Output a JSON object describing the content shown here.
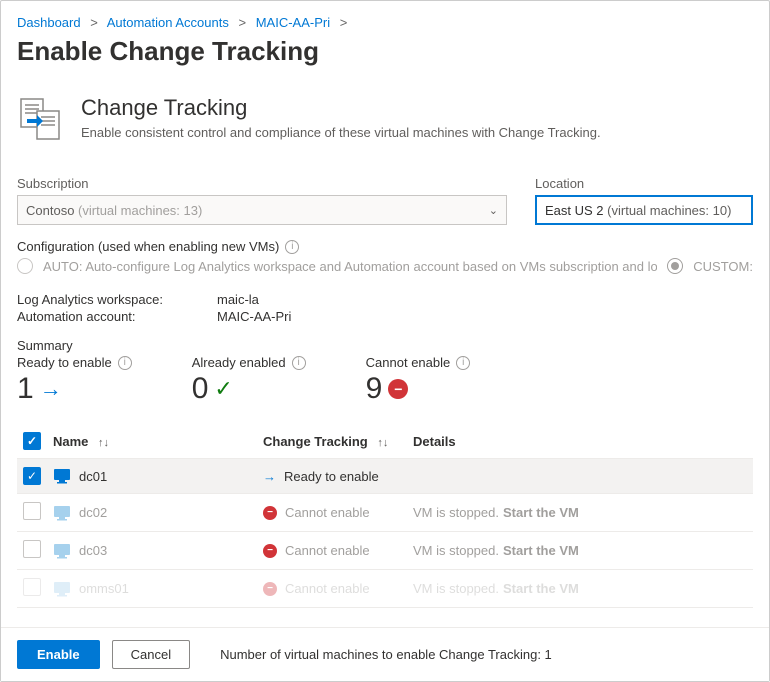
{
  "breadcrumb": {
    "items": [
      "Dashboard",
      "Automation Accounts",
      "MAIC-AA-Pri"
    ]
  },
  "page_title": "Enable Change Tracking",
  "hero": {
    "title": "Change Tracking",
    "subtitle": "Enable consistent control and compliance of these virtual machines with Change Tracking."
  },
  "subscription": {
    "label": "Subscription",
    "value": "Contoso",
    "count_label": "(virtual machines: 13)"
  },
  "location": {
    "label": "Location",
    "value": "East US 2",
    "count_label": "(virtual machines: 10)"
  },
  "config": {
    "label": "Configuration (used when enabling new VMs)",
    "auto_text": "AUTO: Auto-configure Log Analytics workspace and Automation account based on VMs subscription and location",
    "custom_text": "CUSTOM:"
  },
  "workspace": {
    "label": "Log Analytics workspace:",
    "value": "maic-la"
  },
  "automation": {
    "label": "Automation account:",
    "value": "MAIC-AA-Pri"
  },
  "summary": {
    "title": "Summary",
    "ready_label": "Ready to enable",
    "ready_value": "1",
    "already_label": "Already enabled",
    "already_value": "0",
    "cannot_label": "Cannot enable",
    "cannot_value": "9"
  },
  "table": {
    "headers": {
      "name": "Name",
      "change_tracking": "Change Tracking",
      "details": "Details"
    },
    "rows": [
      {
        "checked": true,
        "enabled": true,
        "name": "dc01",
        "status": "Ready to enable",
        "status_icon": "arrow",
        "details": "",
        "action": ""
      },
      {
        "checked": false,
        "enabled": false,
        "name": "dc02",
        "status": "Cannot enable",
        "status_icon": "no",
        "details": "VM is stopped.",
        "action": "Start the VM"
      },
      {
        "checked": false,
        "enabled": false,
        "name": "dc03",
        "status": "Cannot enable",
        "status_icon": "no",
        "details": "VM is stopped.",
        "action": "Start the VM"
      },
      {
        "checked": false,
        "enabled": false,
        "name": "omms01",
        "status": "Cannot enable",
        "status_icon": "no",
        "details": "VM is stopped.",
        "action": "Start the VM"
      }
    ]
  },
  "footer": {
    "enable": "Enable",
    "cancel": "Cancel",
    "count_text": "Number of virtual machines to enable Change Tracking: 1"
  }
}
